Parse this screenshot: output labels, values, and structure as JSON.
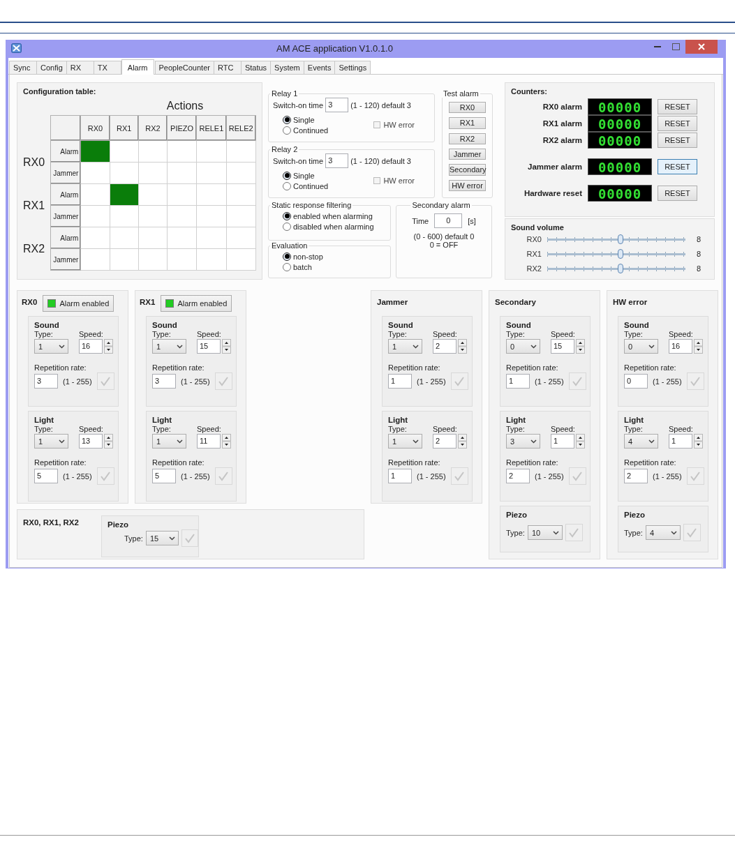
{
  "window": {
    "title": "AM ACE application V1.0.1.0"
  },
  "tabs": [
    {
      "label": "Sync",
      "selected": false
    },
    {
      "label": "Config",
      "selected": false
    },
    {
      "label": "RX",
      "selected": false
    },
    {
      "label": "TX",
      "selected": false
    },
    {
      "label": "Alarm",
      "selected": true
    },
    {
      "label": "PeopleCounter",
      "selected": false
    },
    {
      "label": "RTC",
      "selected": false
    },
    {
      "label": "Status",
      "selected": false
    },
    {
      "label": "System",
      "selected": false
    },
    {
      "label": "Events",
      "selected": false
    },
    {
      "label": "Settings",
      "selected": false
    }
  ],
  "config_table": {
    "title": "Configuration table:",
    "heading": "Actions",
    "columns": [
      "RX0",
      "RX1",
      "RX2",
      "PIEZO",
      "RELE1",
      "RELE2"
    ],
    "groups": [
      {
        "label": "RX0",
        "rows": [
          {
            "label": "Alarm",
            "cells": [
              true,
              false,
              false,
              false,
              false,
              false
            ]
          },
          {
            "label": "Jammer",
            "cells": [
              false,
              false,
              false,
              false,
              false,
              false
            ]
          }
        ]
      },
      {
        "label": "RX1",
        "rows": [
          {
            "label": "Alarm",
            "cells": [
              false,
              true,
              false,
              false,
              false,
              false
            ]
          },
          {
            "label": "Jammer",
            "cells": [
              false,
              false,
              false,
              false,
              false,
              false
            ]
          }
        ]
      },
      {
        "label": "RX2",
        "rows": [
          {
            "label": "Alarm",
            "cells": [
              false,
              false,
              false,
              false,
              false,
              false
            ]
          },
          {
            "label": "Jammer",
            "cells": [
              false,
              false,
              false,
              false,
              false,
              false
            ]
          }
        ]
      }
    ]
  },
  "relays": [
    {
      "title": "Relay 1",
      "switch_label": "Switch-on time",
      "value": "3",
      "range": "(1 - 120) default 3",
      "modes": [
        {
          "label": "Single",
          "selected": true
        },
        {
          "label": "Continued",
          "selected": false
        }
      ],
      "hw_error": {
        "label": "HW error",
        "checked": false,
        "disabled": true
      }
    },
    {
      "title": "Relay 2",
      "switch_label": "Switch-on time",
      "value": "3",
      "range": "(1 - 120) default 3",
      "modes": [
        {
          "label": "Single",
          "selected": true
        },
        {
          "label": "Continued",
          "selected": false
        }
      ],
      "hw_error": {
        "label": "HW error",
        "checked": false,
        "disabled": true
      }
    }
  ],
  "test_alarm": {
    "title": "Test alarm",
    "buttons": [
      "RX0",
      "RX1",
      "RX2",
      "Jammer",
      "Secondary",
      "HW error"
    ]
  },
  "static_filter": {
    "title": "Static response filtering",
    "options": [
      {
        "label": "enabled when alarming",
        "selected": true
      },
      {
        "label": "disabled when alarming",
        "selected": false
      }
    ]
  },
  "evaluation": {
    "title": "Evaluation",
    "options": [
      {
        "label": "non-stop",
        "selected": true
      },
      {
        "label": "batch",
        "selected": false
      }
    ]
  },
  "secondary_alarm": {
    "title": "Secondary alarm",
    "label": "Time",
    "value": "0",
    "unit": "[s]",
    "note": "(0 - 600) default 0",
    "note_2": "0 = OFF"
  },
  "counters": {
    "title": "Counters:",
    "items": [
      {
        "label": "RX0 alarm",
        "value": "00000",
        "button": "RESET",
        "focused": false
      },
      {
        "label": "RX1 alarm",
        "value": "00000",
        "button": "RESET",
        "focused": false
      },
      {
        "label": "RX2 alarm",
        "value": "00000",
        "button": "RESET",
        "focused": false
      },
      {
        "label": "Jammer alarm",
        "value": "00000",
        "button": "RESET",
        "focused": true
      },
      {
        "label": "Hardware reset",
        "value": "00000",
        "button": "RESET",
        "focused": false
      }
    ]
  },
  "sound_volume": {
    "title": "Sound volume",
    "channels": [
      {
        "name": "RX0",
        "level": 0.53,
        "reading": "8"
      },
      {
        "name": "RX1",
        "level": 0.53,
        "reading": "8"
      },
      {
        "name": "RX2",
        "level": 0.53,
        "reading": "8"
      }
    ]
  },
  "alarm_panels": [
    {
      "title": "RX0",
      "enable_button": {
        "label": "Alarm enabled",
        "on": true
      },
      "sections": [
        {
          "kind": "pattern",
          "title": "Sound",
          "type_label": "Type:",
          "type": "1",
          "speed_label": "Speed:",
          "speed": "16",
          "rate_label": "Repetition rate:",
          "rate": "3",
          "range": "(1 - 255)"
        },
        {
          "kind": "pattern",
          "title": "Light",
          "type_label": "Type:",
          "type": "1",
          "speed_label": "Speed:",
          "speed": "13",
          "rate_label": "Repetition rate:",
          "rate": "5",
          "range": "(1 - 255)"
        }
      ]
    },
    {
      "title": "RX1",
      "enable_button": {
        "label": "Alarm enabled",
        "on": true
      },
      "sections": [
        {
          "kind": "pattern",
          "title": "Sound",
          "type_label": "Type:",
          "type": "1",
          "speed_label": "Speed:",
          "speed": "15",
          "rate_label": "Repetition rate:",
          "rate": "3",
          "range": "(1 - 255)"
        },
        {
          "kind": "pattern",
          "title": "Light",
          "type_label": "Type:",
          "type": "1",
          "speed_label": "Speed:",
          "speed": "11",
          "rate_label": "Repetition rate:",
          "rate": "5",
          "range": "(1 - 255)"
        }
      ]
    },
    {
      "title": "Jammer",
      "sections": [
        {
          "kind": "pattern",
          "title": "Sound",
          "type_label": "Type:",
          "type": "1",
          "speed_label": "Speed:",
          "speed": "2",
          "rate_label": "Repetition rate:",
          "rate": "1",
          "range": "(1 - 255)"
        },
        {
          "kind": "pattern",
          "title": "Light",
          "type_label": "Type:",
          "type": "1",
          "speed_label": "Speed:",
          "speed": "2",
          "rate_label": "Repetition rate:",
          "rate": "1",
          "range": "(1 - 255)"
        }
      ]
    },
    {
      "title": "Secondary",
      "sections": [
        {
          "kind": "pattern",
          "title": "Sound",
          "type_label": "Type:",
          "type": "0",
          "speed_label": "Speed:",
          "speed": "15",
          "rate_label": "Repetition rate:",
          "rate": "1",
          "range": "(1 - 255)"
        },
        {
          "kind": "pattern",
          "title": "Light",
          "type_label": "Type:",
          "type": "3",
          "speed_label": "Speed:",
          "speed": "1",
          "rate_label": "Repetition rate:",
          "rate": "2",
          "range": "(1 - 255)"
        },
        {
          "kind": "piezo",
          "title": "Piezo",
          "type_label": "Type:",
          "type": "10"
        }
      ]
    },
    {
      "title": "HW error",
      "sections": [
        {
          "kind": "pattern",
          "title": "Sound",
          "type_label": "Type:",
          "type": "0",
          "speed_label": "Speed:",
          "speed": "16",
          "rate_label": "Repetition rate:",
          "rate": "0",
          "range": "(1 - 255)"
        },
        {
          "kind": "pattern",
          "title": "Light",
          "type_label": "Type:",
          "type": "4",
          "speed_label": "Speed:",
          "speed": "1",
          "rate_label": "Repetition rate:",
          "rate": "2",
          "range": "(1 - 255)"
        },
        {
          "kind": "piezo",
          "title": "Piezo",
          "type_label": "Type:",
          "type": "4"
        }
      ]
    }
  ],
  "common_panel": {
    "title": "RX0, RX1, RX2",
    "sections": [
      {
        "kind": "piezo",
        "title": "Piezo",
        "type_label": "Type:",
        "type": "15"
      }
    ]
  }
}
